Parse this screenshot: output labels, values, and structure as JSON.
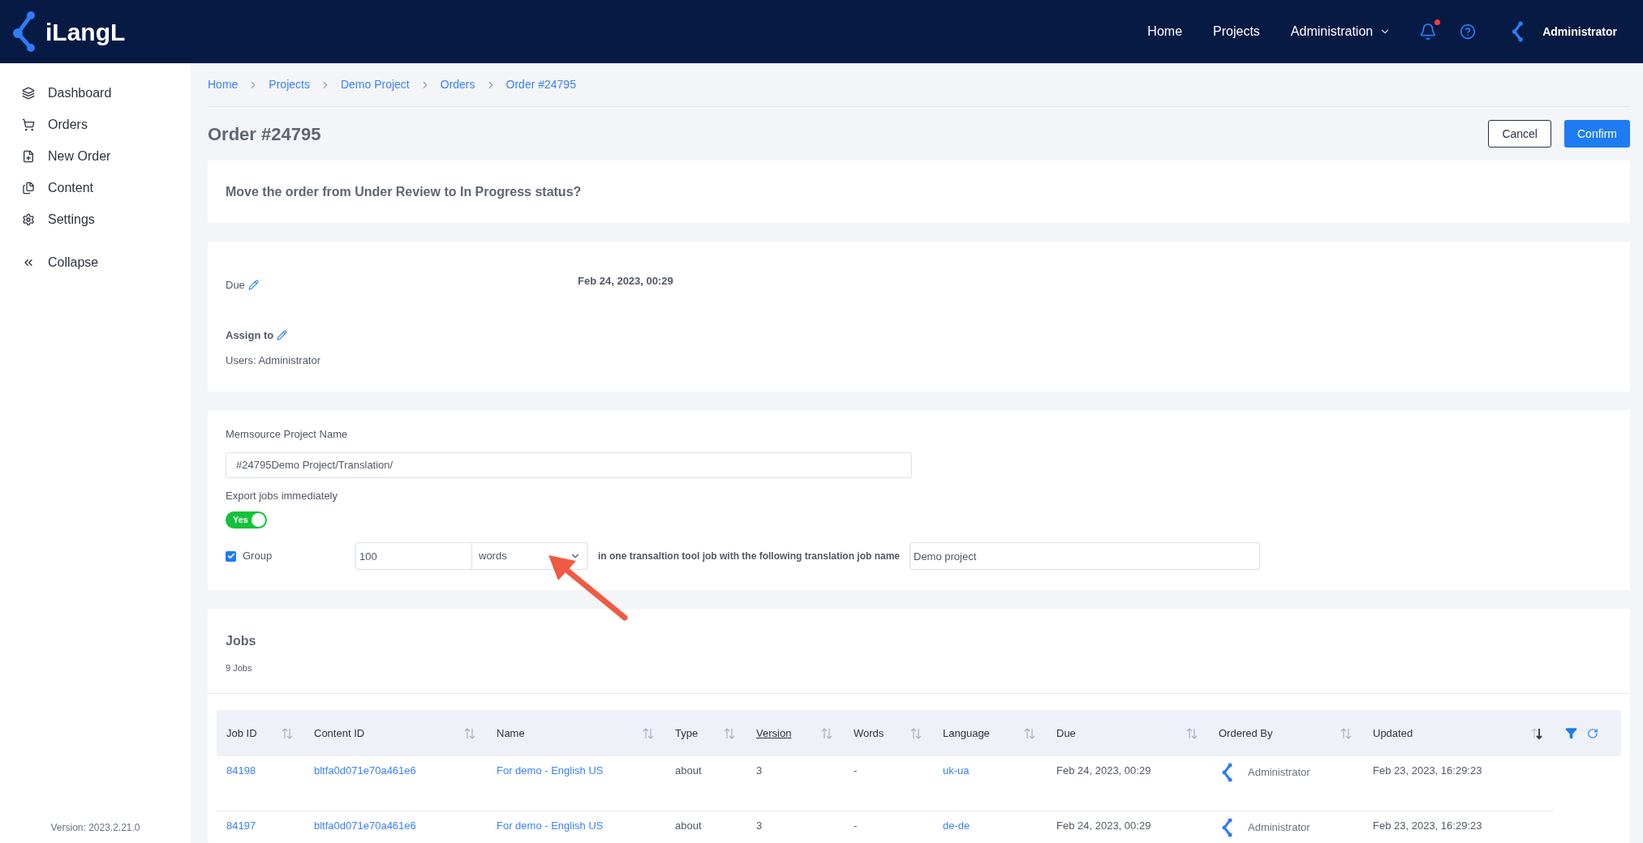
{
  "header": {
    "logo": "iLangL",
    "nav": [
      "Home",
      "Projects",
      "Administration"
    ],
    "notifications": {
      "unread": true
    },
    "user": "Administrator"
  },
  "sidebar": {
    "items": [
      {
        "label": "Dashboard"
      },
      {
        "label": "Orders"
      },
      {
        "label": "New Order"
      },
      {
        "label": "Content"
      },
      {
        "label": "Settings"
      }
    ],
    "collapse": "Collapse",
    "version": "Version: 2023.2.21.0"
  },
  "breadcrumbs": [
    "Home",
    "Projects",
    "Demo Project",
    "Orders",
    "Order #24795"
  ],
  "title": "Order #24795",
  "buttons": {
    "cancel": "Cancel",
    "confirm": "Confirm"
  },
  "question": "Move the order from Under Review to In Progress status?",
  "details": {
    "due_label": "Due",
    "due_value": "Feb 24, 2023, 00:29",
    "assign_label": "Assign to",
    "users": "Users: Administrator"
  },
  "memsource": {
    "label": "Memsource Project Name",
    "value": "#24795Demo Project/Translation/",
    "export_label": "Export jobs immediately",
    "export": {
      "on": true,
      "text": "Yes"
    },
    "group": {
      "checked": true,
      "label": "Group",
      "count": "100",
      "unit": "words",
      "text": "in one transaltion tool job with the following translation job name",
      "job_name": "Demo project"
    }
  },
  "jobs": {
    "title": "Jobs",
    "count": "9 Jobs",
    "columns": [
      {
        "label": "Job ID",
        "sorted": false,
        "underlined": false
      },
      {
        "label": "Content ID",
        "sorted": false,
        "underlined": false
      },
      {
        "label": "Name",
        "sorted": false,
        "underlined": false
      },
      {
        "label": "Type",
        "sorted": false,
        "underlined": false
      },
      {
        "label": "Version",
        "sorted": false,
        "underlined": true
      },
      {
        "label": "Words",
        "sorted": false,
        "underlined": false
      },
      {
        "label": "Language",
        "sorted": false,
        "underlined": false
      },
      {
        "label": "Due",
        "sorted": false,
        "underlined": false
      },
      {
        "label": "Ordered By",
        "sorted": false,
        "underlined": false
      },
      {
        "label": "Updated",
        "sorted": true,
        "underlined": false
      }
    ],
    "rows": [
      {
        "job_id": "84198",
        "content_id": "bltfa0d071e70a461e6",
        "name": "For demo - English US",
        "type": "about",
        "version": "3",
        "words": "-",
        "language": "uk-ua",
        "due": "Feb 24, 2023, 00:29",
        "ordered_by": "Administrator",
        "updated": "Feb 23, 2023, 16:29:23"
      },
      {
        "job_id": "84197",
        "content_id": "bltfa0d071e70a461e6",
        "name": "For demo - English US",
        "type": "about",
        "version": "3",
        "words": "-",
        "language": "de-de",
        "due": "Feb 24, 2023, 00:29",
        "ordered_by": "Administrator",
        "updated": "Feb 23, 2023, 16:29:23"
      }
    ]
  }
}
